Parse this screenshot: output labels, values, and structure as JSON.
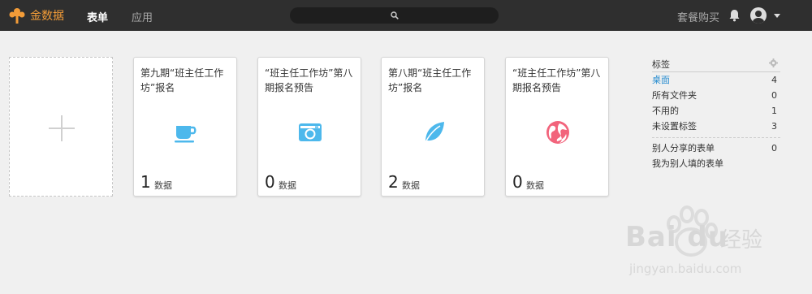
{
  "header": {
    "brand": "金数据",
    "nav": [
      "表单",
      "应用"
    ],
    "buy": "套餐购买"
  },
  "add_card": {
    "icon": "plus-icon"
  },
  "cards": [
    {
      "title": "第九期“班主任工作坊”报名",
      "icon": "coffee-cup-icon",
      "icon_color": "#4db8ec",
      "count": "1",
      "count_label": "数据"
    },
    {
      "title": "“班主任工作坊”第八期报名预告",
      "icon": "camera-icon",
      "icon_color": "#4db8ec",
      "count": "0",
      "count_label": "数据"
    },
    {
      "title": "第八期“班主任工作坊”报名",
      "icon": "leaf-icon",
      "icon_color": "#4db8ec",
      "count": "2",
      "count_label": "数据"
    },
    {
      "title": "“班主任工作坊”第八期报名预告",
      "icon": "globe-icon",
      "icon_color": "#f2647c",
      "count": "0",
      "count_label": "数据"
    }
  ],
  "tags": {
    "title": "标签",
    "items": [
      {
        "label": "桌面",
        "count": "4"
      },
      {
        "label": "所有文件夹",
        "count": "0"
      },
      {
        "label": "不用的",
        "count": "1"
      },
      {
        "label": "未设置标签",
        "count": "3"
      }
    ],
    "shared": [
      {
        "label": "别人分享的表单",
        "count": "0"
      },
      {
        "label": "我为别人填的表单",
        "count": ""
      }
    ]
  },
  "watermark": {
    "brand": "Bai du",
    "product": "经验",
    "url": "jingyan.baidu.com"
  },
  "colors": {
    "topbar": "#2f2f2f",
    "brand": "#f39c38",
    "accent_blue": "#4db8ec",
    "accent_pink": "#f2647c",
    "link": "#2a8ed0"
  }
}
